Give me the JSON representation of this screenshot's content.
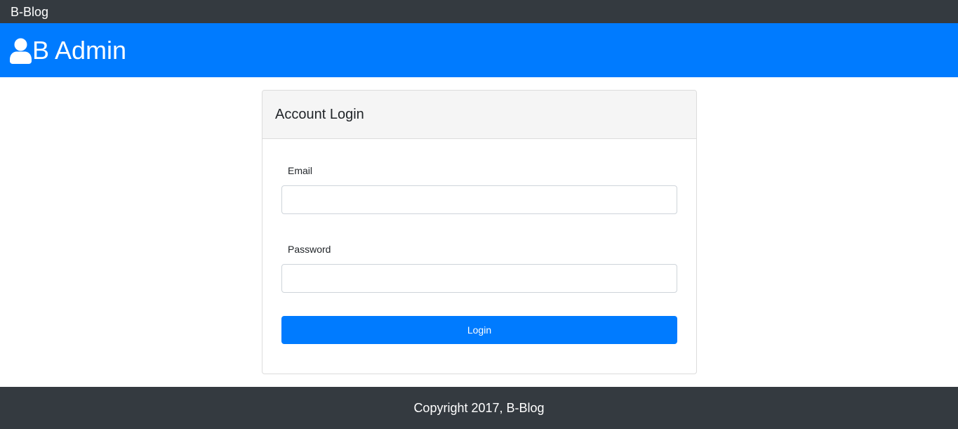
{
  "navbar": {
    "brand": "B-Blog"
  },
  "header": {
    "icon": "user-icon",
    "title": "B Admin"
  },
  "login_card": {
    "title": "Account Login",
    "email_label": "Email",
    "email_value": "",
    "email_placeholder": "",
    "password_label": "Password",
    "password_value": "",
    "password_placeholder": "",
    "submit_label": "Login"
  },
  "footer": {
    "text": "Copyright 2017, B-Blog"
  },
  "colors": {
    "navbar_bg": "#343a40",
    "header_bg": "#007bff",
    "primary_button": "#007bff",
    "card_header_bg": "#f5f5f5",
    "footer_bg": "#343a40"
  }
}
